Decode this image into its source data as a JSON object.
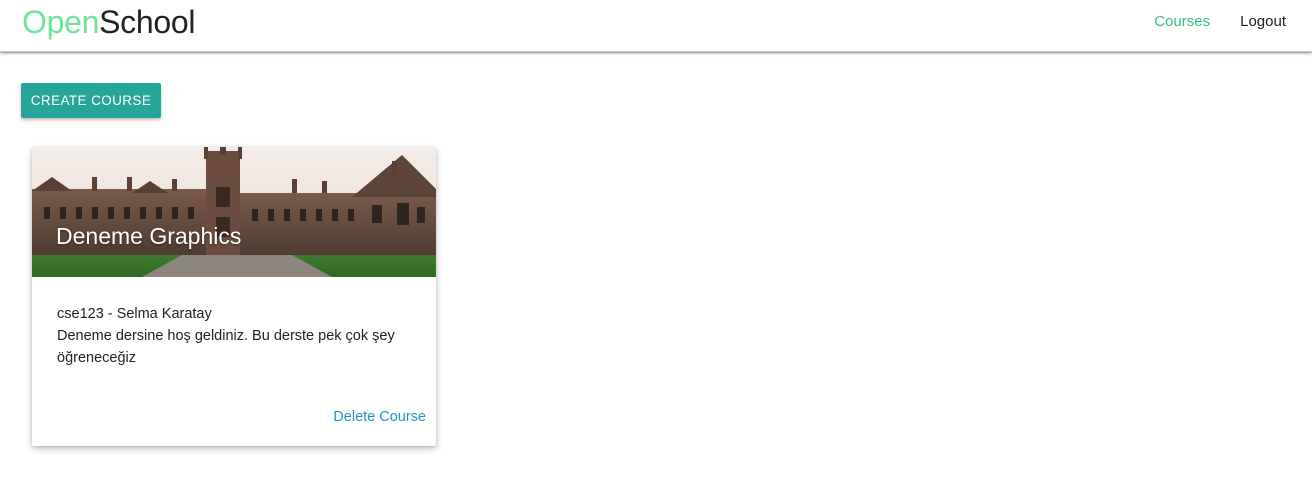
{
  "navbar": {
    "brand_open": "Open",
    "brand_school": "School",
    "links": [
      {
        "label": "Courses",
        "active": true
      },
      {
        "label": "Logout",
        "active": false
      }
    ]
  },
  "toolbar": {
    "create_label": "CREATE COURSE"
  },
  "courses": [
    {
      "title": "Deneme Graphics",
      "code_instructor": "cse123 - Selma Karatay",
      "description": "Deneme dersine hoş geldiniz. Bu derste pek çok şey öğreneceğiz",
      "delete_label": "Delete Course"
    }
  ],
  "colors": {
    "brand_open": "#6fe39a",
    "nav_active": "#35c07a",
    "button": "#26a69a",
    "link": "#2196c4"
  }
}
